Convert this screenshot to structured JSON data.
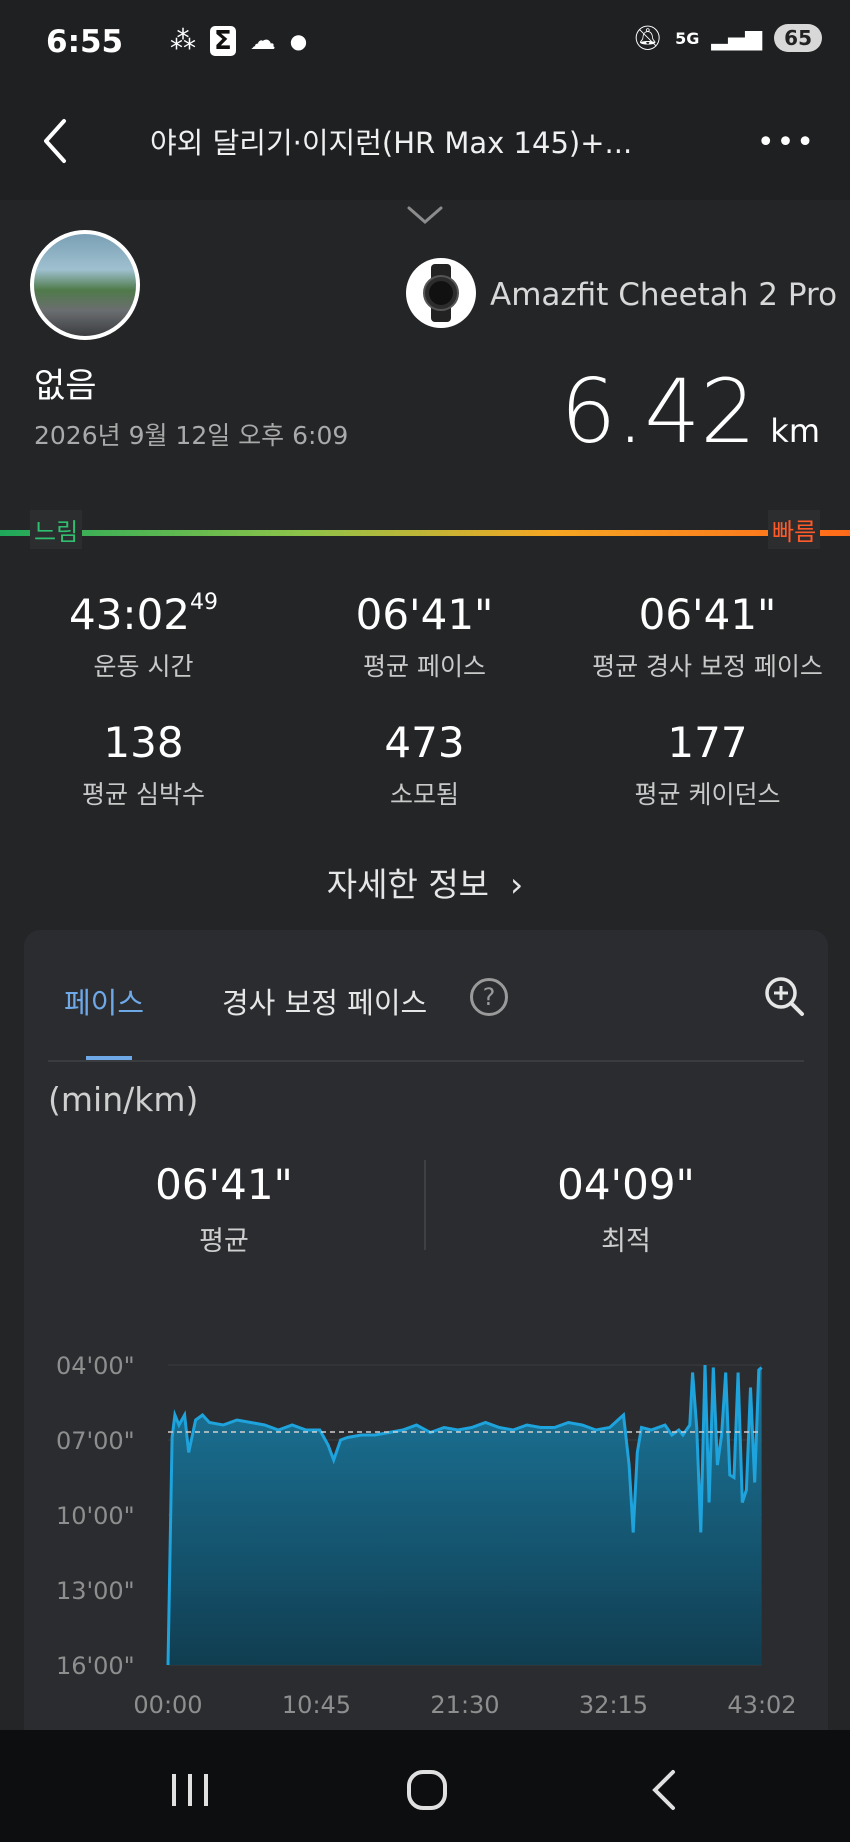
{
  "status_bar": {
    "time": "6:55",
    "carrier": "U⁺",
    "network": "5G",
    "battery": "65"
  },
  "header": {
    "title": "야외 달리기·이지런(HR Max 145)+..."
  },
  "workout": {
    "location": "없음",
    "datetime": "2026년 9월 12일 오후 6:09",
    "device": "Amazfit Cheetah 2 Pro",
    "distance_value": "6.42",
    "distance_unit": "km"
  },
  "speed_scale": {
    "slow": "느림",
    "fast": "빠름"
  },
  "stats": [
    {
      "value": "43:02",
      "value_sup": "49",
      "label": "운동 시간"
    },
    {
      "value": "06'41\"",
      "label": "평균 페이스"
    },
    {
      "value": "06'41\"",
      "label": "평균 경사 보정 페이스"
    },
    {
      "value": "138",
      "label": "평균 심박수"
    },
    {
      "value": "473",
      "label": "소모됨"
    },
    {
      "value": "177",
      "label": "평균 케이던스"
    }
  ],
  "details_link": "자세한 정보",
  "pace_card": {
    "tabs": [
      {
        "label": "페이스",
        "active": true
      },
      {
        "label": "경사 보정 페이스",
        "active": false
      }
    ],
    "unit": "(min/km)",
    "average": {
      "value": "06'41\"",
      "label": "평균"
    },
    "best": {
      "value": "04'09\"",
      "label": "최적"
    }
  },
  "colors": {
    "accent": "#6fa8e6",
    "line": "#1ea3dc"
  },
  "chart_data": {
    "type": "area",
    "title": "",
    "xlabel": "",
    "ylabel": "(min/km)",
    "y_inverted": true,
    "ylim": [
      4,
      16
    ],
    "y_ticks": [
      "04'00\"",
      "07'00\"",
      "10'00\"",
      "13'00\"",
      "16'00\""
    ],
    "x_ticks": [
      "00:00",
      "10:45",
      "21:30",
      "32:15",
      "43:02"
    ],
    "xlim": [
      0,
      43.03
    ],
    "average_line": 6.68,
    "x": [
      0,
      0.3,
      0.5,
      0.8,
      1.2,
      1.5,
      2,
      2.5,
      3,
      4,
      5,
      6,
      7,
      8,
      9,
      10,
      11,
      11.6,
      12,
      12.5,
      13,
      14,
      15,
      16,
      17,
      18,
      19,
      20,
      21,
      22,
      23,
      24,
      25,
      26,
      27,
      28,
      29,
      30,
      31,
      32,
      33,
      33.4,
      33.7,
      34,
      34.3,
      35,
      36,
      36.5,
      37,
      37.3,
      37.8,
      38,
      38.3,
      38.6,
      38.9,
      39.2,
      39.5,
      39.8,
      40.1,
      40.4,
      40.7,
      41,
      41.3,
      41.6,
      41.9,
      42.2,
      42.5,
      42.8,
      43.0
    ],
    "y": [
      16,
      6.9,
      6.0,
      6.4,
      6.0,
      7.5,
      6.2,
      6.0,
      6.3,
      6.4,
      6.2,
      6.3,
      6.4,
      6.6,
      6.4,
      6.6,
      6.6,
      7.2,
      7.8,
      7.0,
      6.9,
      6.8,
      6.8,
      6.7,
      6.6,
      6.4,
      6.7,
      6.5,
      6.6,
      6.5,
      6.3,
      6.5,
      6.6,
      6.4,
      6.5,
      6.5,
      6.3,
      6.4,
      6.6,
      6.5,
      6.0,
      8.0,
      10.7,
      7.5,
      6.5,
      6.6,
      6.4,
      6.8,
      6.6,
      6.8,
      6.4,
      4.3,
      6.5,
      10.7,
      4.0,
      9.5,
      4.1,
      8.0,
      6.8,
      4.3,
      8.4,
      8.5,
      4.3,
      9.5,
      9.0,
      4.9,
      8.7,
      4.2,
      4.1
    ]
  }
}
